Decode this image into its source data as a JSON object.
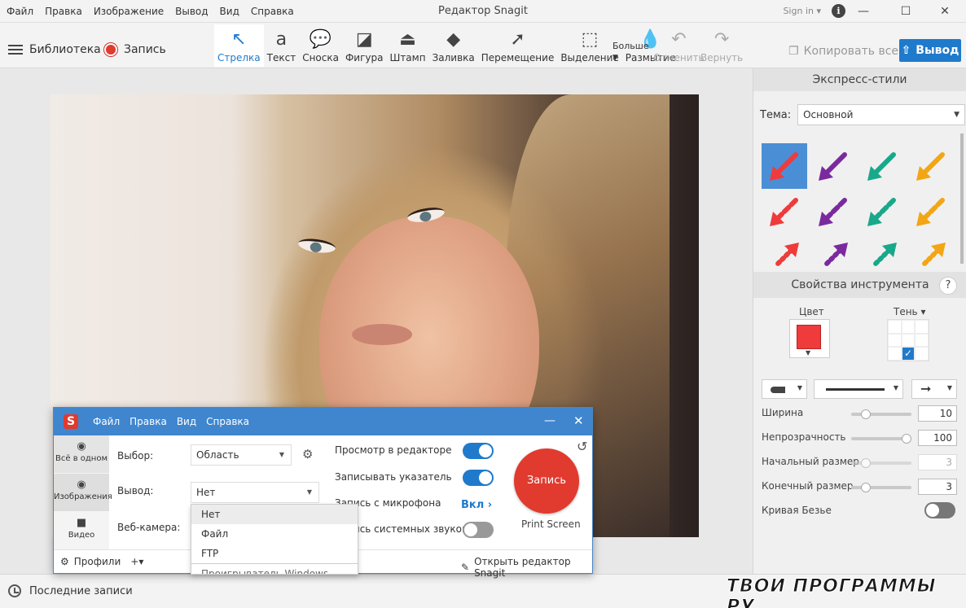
{
  "window": {
    "title": "Редактор Snagit",
    "signin": "Sign in ▾",
    "menu": [
      "Файл",
      "Правка",
      "Изображение",
      "Вывод",
      "Вид",
      "Справка"
    ]
  },
  "toolbar": {
    "library": "Библиотека",
    "record": "Запись",
    "tools": [
      {
        "label": "Стрелка",
        "icon": "arrow-icon",
        "glyph": "↖"
      },
      {
        "label": "Текст",
        "icon": "text-icon",
        "glyph": "a"
      },
      {
        "label": "Сноска",
        "icon": "callout-icon",
        "glyph": "💬"
      },
      {
        "label": "Фигура",
        "icon": "shape-icon",
        "glyph": "◪"
      },
      {
        "label": "Штамп",
        "icon": "stamp-icon",
        "glyph": "⏏"
      },
      {
        "label": "Заливка",
        "icon": "fill-icon",
        "glyph": "◆"
      },
      {
        "label": "Перемещение",
        "icon": "move-icon",
        "glyph": "➚"
      },
      {
        "label": "Выделение",
        "icon": "selection-icon",
        "glyph": "⬚"
      },
      {
        "label": "Размытие",
        "icon": "blur-icon",
        "glyph": "💧"
      }
    ],
    "more": "Больше",
    "undo": "Отменить",
    "redo": "Вернуть",
    "copy_all": "Копировать все",
    "output": "Вывод"
  },
  "quick_styles": {
    "header": "Экспресс-стили",
    "theme_label": "Тема:",
    "theme_value": "Основной",
    "colors": [
      "#ef3b3b",
      "#7b2a9e",
      "#18a88a",
      "#f2a614"
    ]
  },
  "tool_properties": {
    "header": "Свойства инструмента",
    "help": "?",
    "color_label": "Цвет",
    "color_value": "#ef3b3b",
    "shadow_label": "Тень ▾",
    "width_label": "Ширина",
    "width_value": "10",
    "width_fraction": 0.2,
    "opacity_label": "Непрозрачность",
    "opacity_value": "100",
    "opacity_fraction": 1.0,
    "start_size_label": "Начальный размер",
    "start_size_value": "3",
    "start_size_fraction": 0.2,
    "end_size_label": "Конечный размер",
    "end_size_value": "3",
    "end_size_fraction": 0.2,
    "bezier_label": "Кривая Безье",
    "bezier_on": false
  },
  "status": {
    "recent": "Последние записи",
    "watermark": "ТВОИ ПРОГРАММЫ РУ"
  },
  "capture": {
    "menu": [
      "Файл",
      "Правка",
      "Вид",
      "Справка"
    ],
    "modes": [
      {
        "label": "Всё в одном",
        "icon": "all-in-one-icon",
        "glyph": "◉"
      },
      {
        "label": "Изображения",
        "icon": "camera-icon",
        "glyph": "📷"
      },
      {
        "label": "Видео",
        "icon": "video-icon",
        "glyph": "■"
      }
    ],
    "selection_label": "Выбор:",
    "selection_value": "Область",
    "output_label": "Вывод:",
    "output_value": "Нет",
    "webcam_label": "Веб-камера:",
    "dropdown": [
      "Нет",
      "Файл",
      "FTP",
      "Проигрыватель Windows Media"
    ],
    "preview_label": "Просмотр в редакторе",
    "cursor_label": "Записывать указатель",
    "mic_label": "Запись с микрофона",
    "mic_value": "Вкл",
    "system_audio_label": "Запись системных звуков",
    "record_button": "Запись",
    "hotkey": "Print Screen",
    "profiles": "Профили",
    "open_editor": "Открыть редактор Snagit"
  }
}
